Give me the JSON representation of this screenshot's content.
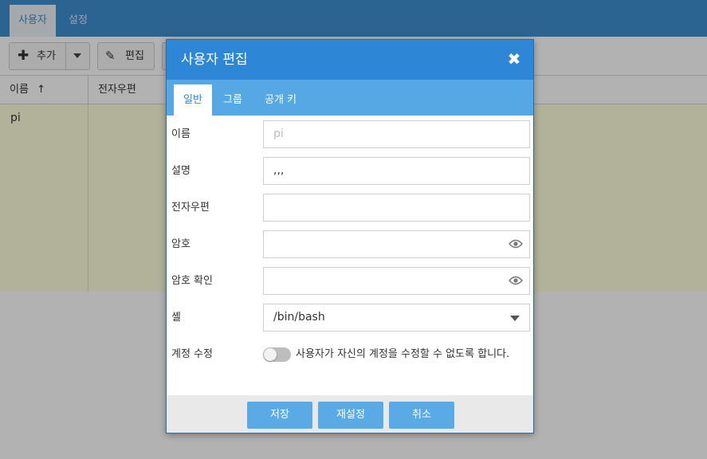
{
  "app": {
    "tabs": [
      "사용자",
      "설정"
    ],
    "toolbar": {
      "add_label": "추가",
      "edit_label": "편집"
    },
    "columns": [
      "이름",
      "전자우편"
    ],
    "rows": [
      {
        "name": "pi",
        "email": ""
      }
    ]
  },
  "modal": {
    "title": "사용자 편집",
    "tabs": [
      "일반",
      "그룹",
      "공개 키"
    ],
    "fields": {
      "name": {
        "label": "이름",
        "placeholder": "pi",
        "value": ""
      },
      "description": {
        "label": "설명",
        "value": ",,,"
      },
      "email": {
        "label": "전자우편",
        "value": ""
      },
      "password": {
        "label": "암호",
        "value": ""
      },
      "password_confirm": {
        "label": "암호 확인",
        "value": ""
      },
      "shell": {
        "label": "셸",
        "value": "/bin/bash"
      },
      "account_edit": {
        "label": "계정 수정",
        "toggle_text": "사용자가 자신의 계정을 수정할 수 없도록 합니다.",
        "enabled": false
      }
    },
    "buttons": {
      "save": "저장",
      "reset": "재설정",
      "cancel": "취소"
    }
  },
  "colors": {
    "primary": "#2e86d6",
    "tab_bar": "#55a8e3",
    "button": "#5aaae6",
    "row_highlight": "#ffffdd"
  }
}
